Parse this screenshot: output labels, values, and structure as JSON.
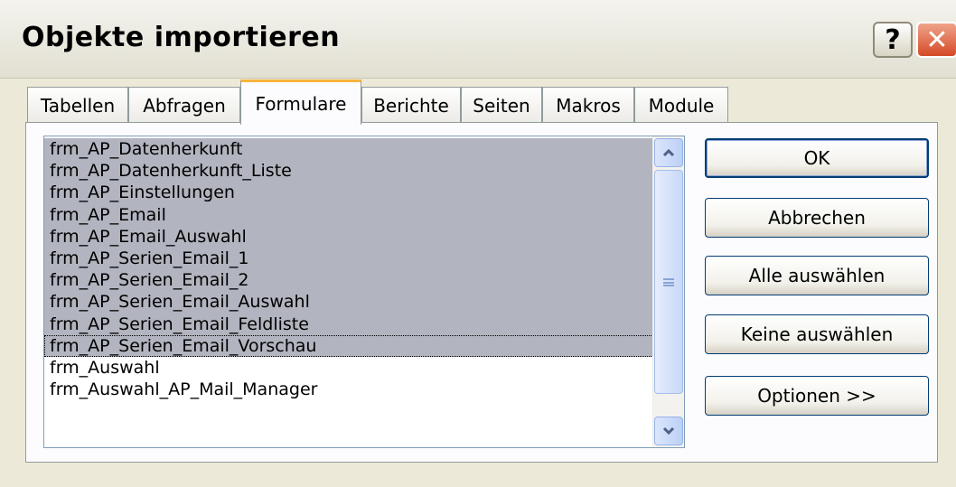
{
  "dialog": {
    "title": "Objekte importieren",
    "help_label": "?",
    "close_label": "✕"
  },
  "tabs": [
    {
      "label": "Tabellen",
      "active": false
    },
    {
      "label": "Abfragen",
      "active": false
    },
    {
      "label": "Formulare",
      "active": true
    },
    {
      "label": "Berichte",
      "active": false
    },
    {
      "label": "Seiten",
      "active": false
    },
    {
      "label": "Makros",
      "active": false
    },
    {
      "label": "Module",
      "active": false
    }
  ],
  "list": {
    "items": [
      {
        "label": "frm_AP_Datenherkunft",
        "selected": true
      },
      {
        "label": "frm_AP_Datenherkunft_Liste",
        "selected": true
      },
      {
        "label": "frm_AP_Einstellungen",
        "selected": true
      },
      {
        "label": "frm_AP_Email",
        "selected": true
      },
      {
        "label": "frm_AP_Email_Auswahl",
        "selected": true
      },
      {
        "label": "frm_AP_Serien_Email_1",
        "selected": true
      },
      {
        "label": "frm_AP_Serien_Email_2",
        "selected": true
      },
      {
        "label": "frm_AP_Serien_Email_Auswahl",
        "selected": true
      },
      {
        "label": "frm_AP_Serien_Email_Feldliste",
        "selected": true
      },
      {
        "label": "frm_AP_Serien_Email_Vorschau",
        "selected": true,
        "focused": true
      },
      {
        "label": "frm_Auswahl",
        "selected": false
      },
      {
        "label": "frm_Auswahl_AP_Mail_Manager",
        "selected": false
      }
    ]
  },
  "buttons": {
    "ok": "OK",
    "cancel": "Abbrechen",
    "select_all": "Alle auswählen",
    "select_none": "Keine auswählen",
    "options": "Optionen >>"
  },
  "colors": {
    "selection": "#b2b4bf",
    "tab_accent": "#f8b43c",
    "close_red": "#d44a26"
  }
}
